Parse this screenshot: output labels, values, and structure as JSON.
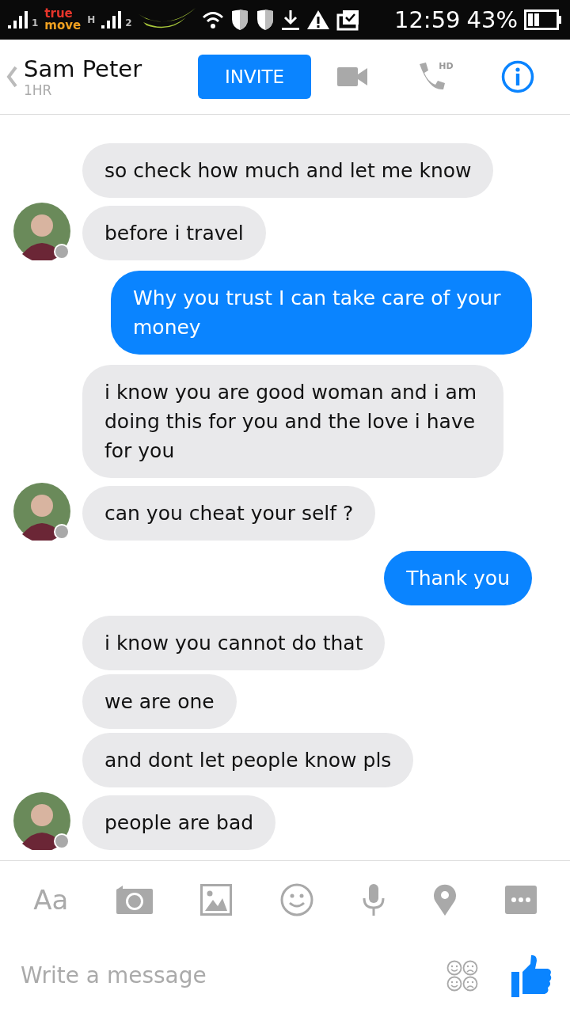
{
  "status_bar": {
    "sim_labels": [
      "1",
      "2"
    ],
    "carrier": [
      "true",
      "move"
    ],
    "network": "H",
    "time": "12:59",
    "battery_text": "43%"
  },
  "header": {
    "name": "Sam Peter",
    "subtitle": "1HR",
    "invite": "INVITE",
    "call_badge": "HD"
  },
  "messages": [
    {
      "kind": "received",
      "text": "so check how much and let me know",
      "avatar": false
    },
    {
      "kind": "received",
      "text": "before i travel",
      "avatar": true
    },
    {
      "kind": "sent",
      "text": "Why you trust I can take care of your money"
    },
    {
      "kind": "received",
      "text": "i know you are good woman and i am doing this for you and the love i have for you",
      "avatar": false
    },
    {
      "kind": "received",
      "text": "can you cheat your self ?",
      "avatar": true
    },
    {
      "kind": "sent",
      "text": "Thank you"
    },
    {
      "kind": "received",
      "text": "i know you cannot do that",
      "avatar": false
    },
    {
      "kind": "received",
      "text": "we are one",
      "avatar": false
    },
    {
      "kind": "received",
      "text": "and dont let people know pls",
      "avatar": false
    },
    {
      "kind": "received",
      "text": "people are bad",
      "avatar": true
    }
  ],
  "toolbar": {
    "text_button": "Aa"
  },
  "composer": {
    "placeholder": "Write a message"
  }
}
